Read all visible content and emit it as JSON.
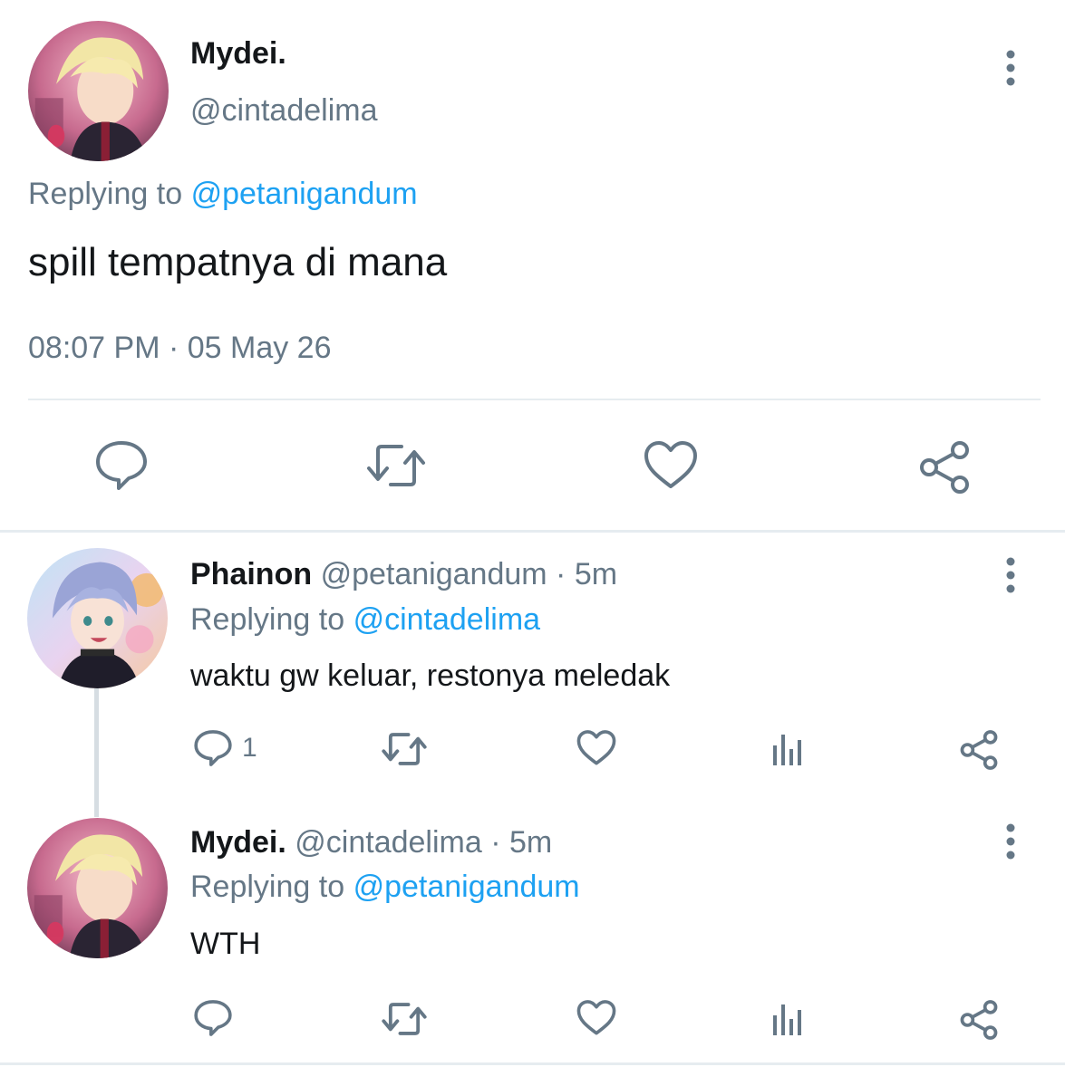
{
  "main_tweet": {
    "display_name": "Mydei.",
    "handle": "@cintadelima",
    "replying_prefix": "Replying to",
    "replying_to": "@petanigandum",
    "text": "spill tempatnya di mana",
    "timestamp": "08:07 PM · 05 May 26",
    "actions": {
      "reply_icon": "speech-bubble-icon",
      "retweet_icon": "retweet-icon",
      "like_icon": "heart-icon",
      "share_icon": "share-icon"
    }
  },
  "replies": [
    {
      "display_name": "Phainon",
      "handle": "@petanigandum",
      "separator": " · ",
      "time": "5m",
      "replying_prefix": "Replying to",
      "replying_to": "@cintadelima",
      "text": "waktu gw keluar, restonya meledak",
      "reply_count": "1"
    },
    {
      "display_name": "Mydei.",
      "handle": "@cintadelima",
      "separator": " · ",
      "time": "5m",
      "replying_prefix": "Replying to",
      "replying_to": "@petanigandum",
      "text": "WTH",
      "reply_count": ""
    }
  ],
  "colors": {
    "text_primary": "#14171a",
    "text_secondary": "#657786",
    "accent": "#1da1f2",
    "divider": "#e6ecf0",
    "icon": "#657786"
  }
}
